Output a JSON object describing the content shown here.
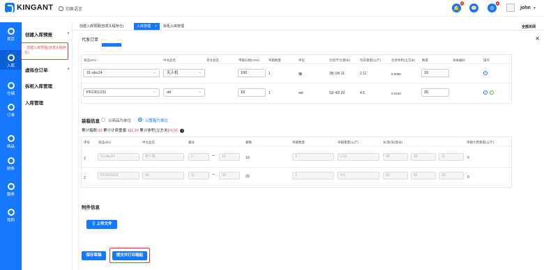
{
  "brand": {
    "name": "KINGANT",
    "color": "#1677ff"
  },
  "topbar": {
    "language": "切换语言",
    "badges": [
      "4",
      "4"
    ],
    "user": "john"
  },
  "rail": [
    {
      "label": "首页",
      "icon": "dashboard-icon"
    },
    {
      "label": "入库",
      "icon": "inbound-icon"
    },
    {
      "label": "仓储",
      "icon": "warehouse-icon"
    },
    {
      "label": "订单",
      "icon": "order-icon"
    },
    {
      "label": "商品",
      "icon": "goods-icon"
    },
    {
      "label": "财务",
      "icon": "finance-icon"
    },
    {
      "label": "服务",
      "icon": "service-icon"
    },
    {
      "label": "我的",
      "icon": "profile-icon"
    }
  ],
  "submenu": {
    "group1": "创建入库预报",
    "group1_item": "· 创建入库预报(自发头程存仓)",
    "group2": "虚拟仓订单",
    "item3": "拆柜入库管理",
    "item4": "入库管理"
  },
  "tabs": [
    "创建入库预报(自发头程存仓)",
    "入库管理",
    "拆柜入库管理"
  ],
  "close_all": "全部关闭",
  "order_title": "代发订单",
  "table1": {
    "headers": [
      "商品SKU",
      "中文品名",
      "英文品名",
      "申报价格(USD)",
      "单箱数量",
      "单位",
      "包装尺寸(厘米)",
      "包装重量(公斤)",
      "包装体积(立方米)",
      "数量",
      "海关编码",
      "操作"
    ],
    "rows": [
      {
        "sku": "31-sku14",
        "cn": "无人机",
        "price": "100",
        "qty_box": "1",
        "unit": "辆",
        "dims": "28/ 18/ 11",
        "weight": "2.11",
        "volume": "0.0055",
        "qty": "10"
      },
      {
        "sku": "PF2301231",
        "cn": "dd",
        "price": "10",
        "qty_box": "1",
        "unit": "set",
        "dims": "53/ 42/ 20",
        "weight": "4.5",
        "volume": "0.0445",
        "qty": "20"
      }
    ]
  },
  "packing": {
    "title": "装箱信息",
    "option1": "以商品为单位",
    "option2": "以整箱为单位",
    "summary_prefix": "累计箱数:",
    "boxes": "30",
    "weight_label": " 累计计费重量:",
    "weight": "111.10",
    "volume_label": " 累计体积(立方米):",
    "volume": "0.00",
    "info_icon": "i"
  },
  "table2": {
    "headers": [
      "序号",
      "商品SKU",
      "中文品名",
      "箱号",
      "箱数",
      "单箱数量",
      "单箱重量(公斤)",
      "长/宽/高(厘米)",
      "单箱计费重量(公斤)"
    ],
    "rows": [
      {
        "no": "1",
        "sku": "31-sku14",
        "cn": "无人机",
        "from": "1",
        "to": "10",
        "boxes": "10",
        "qty": "1",
        "weight": "2.11",
        "l": "28",
        "w": "18",
        "h": "11",
        "bill": "0"
      },
      {
        "no": "2",
        "sku": "PF2301231",
        "cn": "dd",
        "from": "11",
        "to": "30",
        "boxes": "20",
        "qty": "1",
        "weight": "4.5",
        "l": "53",
        "w": "42",
        "h": "20",
        "bill": "0"
      }
    ]
  },
  "attachment": {
    "title": "附件信息",
    "upload": "上传文件"
  },
  "actions": {
    "save_draft": "保存草稿",
    "submit_print": "提交并打印箱贴"
  }
}
